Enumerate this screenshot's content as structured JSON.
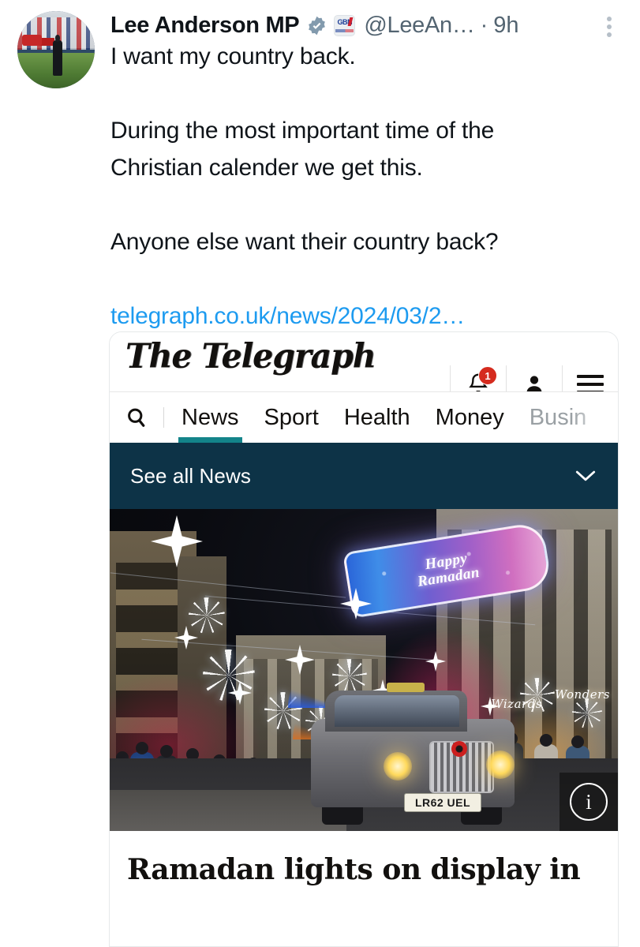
{
  "tweet": {
    "author": {
      "display_name": "Lee Anderson MP",
      "verified_badge": "verified-badge-icon",
      "affiliate_badge_label": "GBN",
      "affiliate_badge_sub": "BRITAIN'S NEWS CHANNEL",
      "handle": "@LeeAn…",
      "separator": "·",
      "timestamp": "9h"
    },
    "more_options": "more-options-icon",
    "body": {
      "line_1": "I want my country back.",
      "line_2": "During the most important time of the",
      "line_3": "Christian calender we get this.",
      "line_4": "Anyone else want their country back?",
      "link_text": "telegraph.co.uk/news/2024/03/2…"
    }
  },
  "card": {
    "masthead": "The Telegraph",
    "tools": {
      "bell_icon": "notification-bell-icon",
      "bell_badge_count": "1",
      "account_icon": "account-person-icon",
      "menu_icon": "hamburger-menu-icon"
    },
    "nav": {
      "search_icon": "search-icon",
      "items": [
        {
          "label": "News",
          "active": true
        },
        {
          "label": "Sport",
          "active": false
        },
        {
          "label": "Health",
          "active": false
        },
        {
          "label": "Money",
          "active": false
        },
        {
          "label": "Busin",
          "active": false
        }
      ],
      "active_underline_color": "#13848a"
    },
    "section_bar": {
      "label": "See all News",
      "chevron_icon": "chevron-down-icon",
      "background_color": "#0d3347"
    },
    "photo": {
      "alt_summary": "Ramadan lights over a London street at night with a black cab",
      "sign_line_1": "Happy",
      "sign_line_2": "Ramadan",
      "taxi_plate": "LR62 UEL",
      "shop_sign_1": "Wizards",
      "shop_sign_2": "Wonders",
      "info_button": "image-info-button",
      "info_glyph": "i"
    },
    "headline_line_1": "Ramadan lights on display in",
    "headline_line_2": ""
  },
  "colors": {
    "link_blue": "#1d9bf0",
    "text_primary": "#0f1419",
    "text_secondary": "#536471",
    "telegraph_navy": "#0d3347",
    "telegraph_teal": "#13848a",
    "badge_red": "#d52b1e"
  }
}
